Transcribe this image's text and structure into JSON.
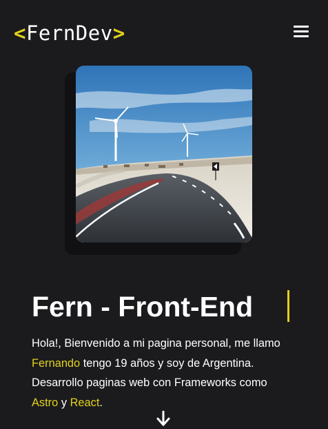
{
  "header": {
    "logo": {
      "open": "<",
      "name": "FernDev",
      "close": ">"
    },
    "menu_icon": "hamburger-menu-icon"
  },
  "hero": {
    "photo_icon": "landscape-road-wind-turbines-photo",
    "title": "Fern - Front-End",
    "intro": {
      "part1": "Hola!, Bienvenido a mi pagina personal, me llamo ",
      "name": "Fernando",
      "part2": " tengo 19 años y soy de Argentina. Desarrollo paginas web con Frameworks como ",
      "framework1": "Astro",
      "part3": " y ",
      "framework2": "React",
      "part4": "."
    },
    "scroll_icon": "arrow-down-icon"
  },
  "colors": {
    "background": "#1b1b1e",
    "accent": "#e2d21c",
    "text": "#ffffff"
  }
}
